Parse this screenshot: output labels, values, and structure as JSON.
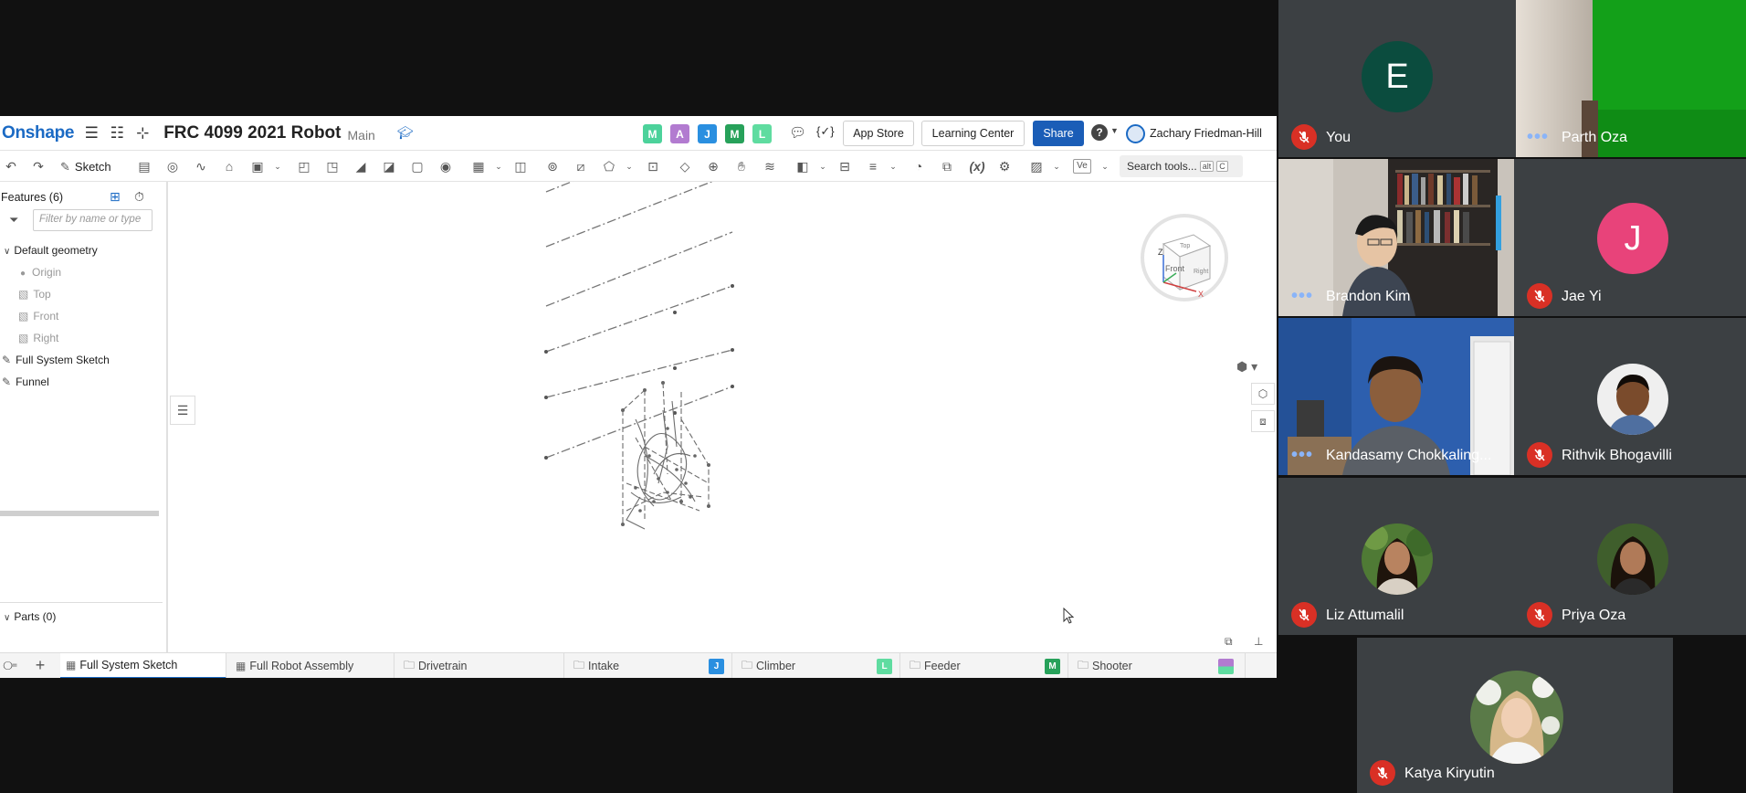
{
  "onshape": {
    "logo": "Onshape",
    "document_title": "FRC 4099 2021 Robot",
    "branch": "Main",
    "collaborators": [
      {
        "initial": "M",
        "color": "#4cd29b"
      },
      {
        "initial": "A",
        "color": "#b27bd0"
      },
      {
        "initial": "J",
        "color": "#2a8fe0"
      },
      {
        "initial": "M",
        "color": "#27a15a"
      },
      {
        "initial": "L",
        "color": "#5fdca0"
      }
    ],
    "header": {
      "app_store": "App Store",
      "learning_center": "Learning Center",
      "share": "Share",
      "user_name": "Zachary Friedman-Hill"
    },
    "toolbar": {
      "sketch_label": "Sketch",
      "search_label": "Search tools...",
      "search_kbd_1": "alt",
      "search_kbd_2": "C",
      "variable_label": "(x)",
      "ve_label": "Ve"
    },
    "features": {
      "title": "Features (6)",
      "filter_placeholder": "Filter by name or type",
      "default_geometry": "Default geometry",
      "origin": "Origin",
      "top": "Top",
      "front": "Front",
      "right": "Right",
      "full_system_sketch": "Full System Sketch",
      "funnel": "Funnel",
      "parts": "Parts (0)"
    },
    "viewcube": {
      "top": "Top",
      "front": "Front",
      "right": "Right",
      "z": "Z",
      "x": "X"
    },
    "tabs": [
      {
        "label": "Full System Sketch",
        "badge": ""
      },
      {
        "label": "Full Robot Assembly",
        "badge": ""
      },
      {
        "label": "Drivetrain",
        "badge": ""
      },
      {
        "label": "Intake",
        "badge": "J",
        "badge_color": "#2a8fe0"
      },
      {
        "label": "Climber",
        "badge": "L",
        "badge_color": "#5fdca0"
      },
      {
        "label": "Feeder",
        "badge": "M",
        "badge_color": "#27a15a"
      },
      {
        "label": "Shooter",
        "badge": "",
        "badge_color": "#b27bd0"
      }
    ]
  },
  "participants": [
    {
      "name": "You",
      "initial": "E",
      "avatar_color": "#0b4c3e",
      "muted": true
    },
    {
      "name": "Parth Oza",
      "muted": false
    },
    {
      "name": "Brandon Kim",
      "muted": false
    },
    {
      "name": "Jae Yi",
      "initial": "J",
      "avatar_color": "#e8437a",
      "muted": true
    },
    {
      "name": "Kandasamy Chokkaling...",
      "muted": false
    },
    {
      "name": "Rithvik Bhogavilli",
      "muted": true
    },
    {
      "name": "Liz Attumalil",
      "muted": true
    },
    {
      "name": "Priya Oza",
      "muted": true
    },
    {
      "name": "Katya Kiryutin",
      "muted": true
    }
  ]
}
